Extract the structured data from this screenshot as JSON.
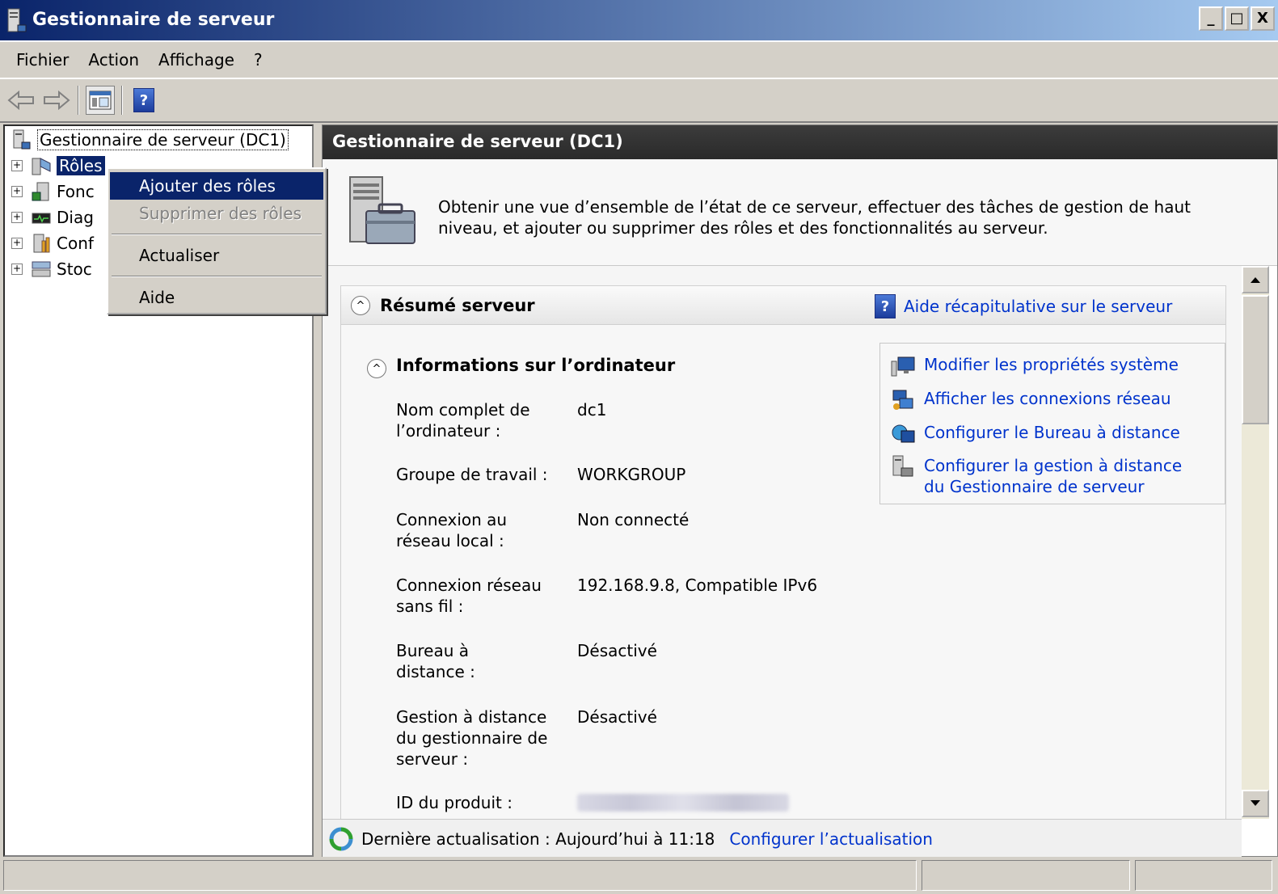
{
  "window": {
    "title": "Gestionnaire de serveur",
    "minimize": "_",
    "maximize": "□",
    "close": "X"
  },
  "menubar": [
    "Fichier",
    "Action",
    "Affichage",
    "?"
  ],
  "toolbar": {
    "help": "?"
  },
  "tree": {
    "root": "Gestionnaire de serveur (DC1)",
    "items": [
      "Rôles",
      "Fonc",
      "Diag",
      "Conf",
      "Stoc"
    ],
    "expand_symbol": "+"
  },
  "context_menu": {
    "items": [
      "Ajouter des rôles",
      "Supprimer des rôles",
      "Actualiser",
      "Aide"
    ]
  },
  "main": {
    "header": "Gestionnaire de serveur (DC1)",
    "intro": "Obtenir une vue d’ensemble de l’état de ce serveur, effectuer des tâches de gestion de haut niveau, et ajouter ou supprimer des rôles et des fonctionnalités au serveur.",
    "summary": {
      "title": "Résumé serveur",
      "help_link": "Aide récapitulative sur le serveur",
      "collapse_symbol": "^",
      "computer_info": {
        "title": "Informations sur l’ordinateur",
        "fields": [
          {
            "label": "Nom complet de l’ordinateur :",
            "value": "dc1"
          },
          {
            "label": "Groupe de travail :",
            "value": "WORKGROUP"
          },
          {
            "label": "Connexion au réseau local :",
            "value": "Non connecté"
          },
          {
            "label": "Connexion réseau sans fil :",
            "value": "192.168.9.8, Compatible IPv6"
          },
          {
            "label": "Bureau à distance :",
            "value": "Désactivé"
          },
          {
            "label": "Gestion à distance du gestionnaire de serveur :",
            "value": "Désactivé"
          },
          {
            "label": "ID du produit :",
            "value": ""
          }
        ]
      },
      "tasks": [
        "Modifier les propriétés système",
        "Afficher les connexions réseau",
        "Configurer le Bureau à distance",
        "Configurer la gestion à distance du Gestionnaire de serveur"
      ]
    },
    "footer": {
      "last_refresh": "Dernière actualisation : Aujourd’hui à 11:18",
      "configure_link": "Configurer l’actualisation"
    }
  },
  "colors": {
    "title_gradient_start": "#0a246a",
    "title_gradient_end": "#a6caf0",
    "header_dark": "#333333",
    "link": "#0033cc",
    "selection": "#0a246a",
    "chrome": "#d4d0c8"
  }
}
